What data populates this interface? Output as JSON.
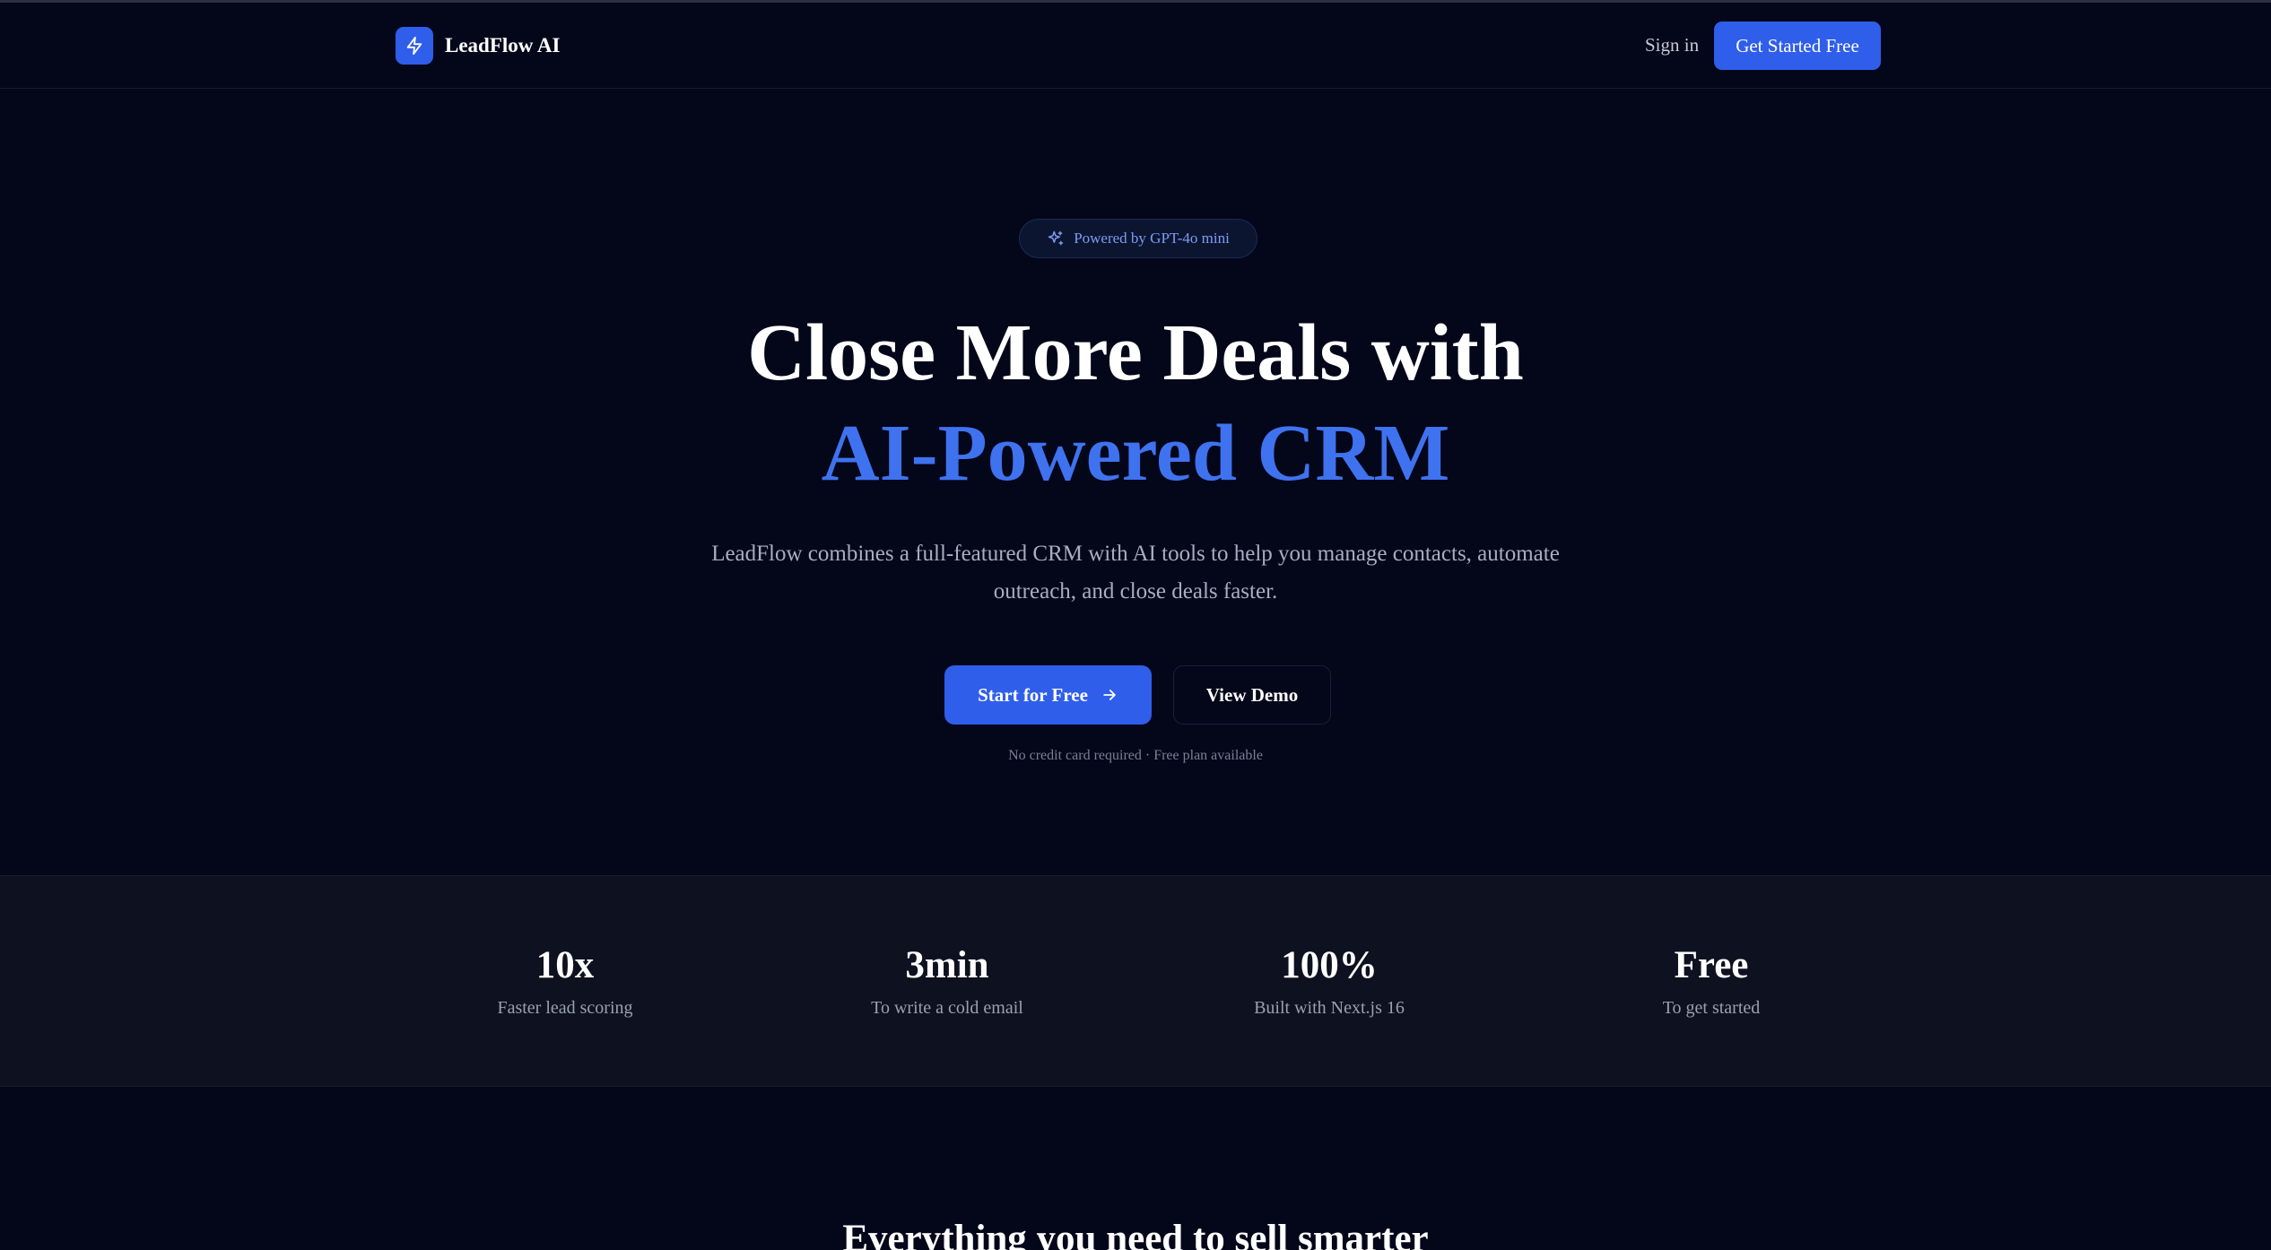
{
  "nav": {
    "brand": "LeadFlow AI",
    "signin": "Sign in",
    "cta": "Get Started Free"
  },
  "hero": {
    "badge": "Powered by GPT-4o mini",
    "title_line1": "Close More Deals with",
    "title_line2": "AI-Powered CRM",
    "subtitle": "LeadFlow combines a full-featured CRM with AI tools to help you manage contacts, automate outreach, and close deals faster.",
    "primary_cta": "Start for Free",
    "secondary_cta": "View Demo",
    "fine_print": "No credit card required · Free plan available"
  },
  "stats": [
    {
      "value": "10x",
      "label": "Faster lead scoring"
    },
    {
      "value": "3min",
      "label": "To write a cold email"
    },
    {
      "value": "100%",
      "label": "Built with Next.js 16"
    },
    {
      "value": "Free",
      "label": "To get started"
    }
  ],
  "features": {
    "title": "Everything you need to sell smarter"
  },
  "icons": {
    "brand_logo": "lightning-bolt-icon",
    "badge": "sparkles-icon",
    "primary_cta": "arrow-right-icon"
  },
  "colors": {
    "background": "#04061a",
    "accent": "#2f5eea",
    "highlight_text": "#3f72ef",
    "stats_band": "#0e111f"
  }
}
